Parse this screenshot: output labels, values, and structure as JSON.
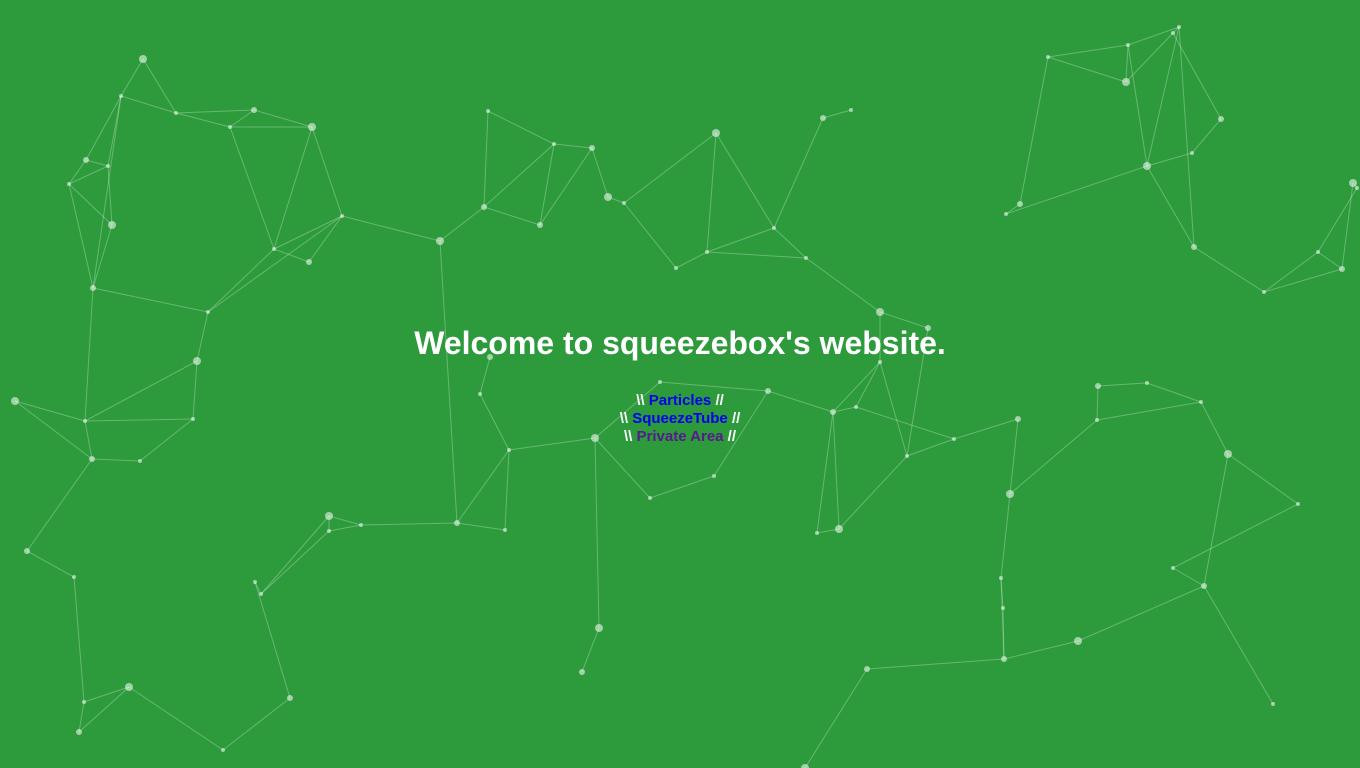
{
  "page": {
    "title": "Welcome to squeezebox's website."
  },
  "links": [
    {
      "left_sep": "\\\\",
      "label": "Particles",
      "right_sep": "//",
      "color": "#0000ee"
    },
    {
      "left_sep": "\\\\",
      "label": "SqueezeTube",
      "right_sep": "//",
      "color": "#0000ee"
    },
    {
      "left_sep": "\\\\",
      "label": "Private Area",
      "right_sep": "//",
      "color": "#551a8b"
    }
  ],
  "colors": {
    "background": "#2d9b3c",
    "text": "#ffffff",
    "particle": "rgba(255,255,255,0.55)",
    "particle_line": "rgba(255,255,255,0.28)"
  },
  "background_effect": "particle-network"
}
